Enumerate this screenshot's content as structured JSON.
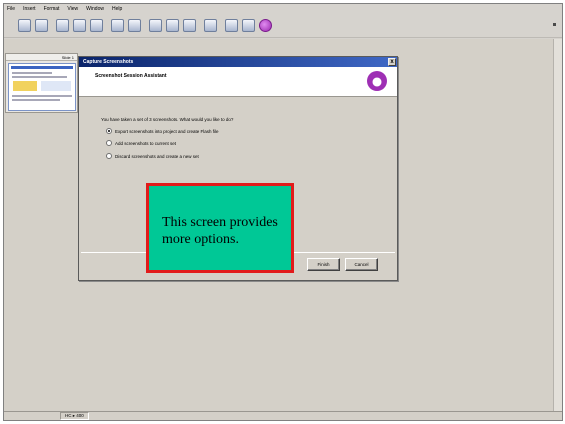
{
  "menu": [
    "File",
    "Insert",
    "Format",
    "View",
    "Window",
    "Help"
  ],
  "thumbnails": {
    "slide_label": "Slide 1"
  },
  "dialog": {
    "title": "Capture Screenshots",
    "close_label": "x",
    "heading": "Screenshot Session Assistant",
    "prompt": "You have taken a set of 3 screenshots. What would you like to do?",
    "options": [
      {
        "label": "Export screenshots into project and create Flash file",
        "selected": true
      },
      {
        "label": "Add screenshots to current set",
        "selected": false
      },
      {
        "label": "Discard screenshots and create a new set",
        "selected": false
      }
    ],
    "buttons": {
      "finish": "Finish",
      "cancel": "Cancel"
    }
  },
  "caption": {
    "text": "This screen provides more options."
  },
  "status": {
    "zoom": "HC ▸ 400"
  },
  "colors": {
    "caption_fill": "#00c896",
    "caption_border": "#e21b1b",
    "titlebar": "#0a246a",
    "logo": "#9e2fb4"
  }
}
